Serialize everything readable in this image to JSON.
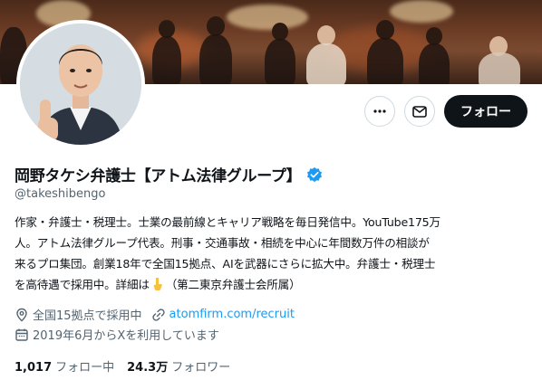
{
  "profile": {
    "display_name": "岡野タケシ弁護士【アトム法律グループ】",
    "handle": "@takeshibengo",
    "bio_line1": "作家・弁護士・税理士。士業の最前線とキャリア戦略を毎日発信中。YouTube175万",
    "bio_line2": "人。アトム法律グループ代表。刑事・交通事故・相続を中心に年間数万件の相談が",
    "bio_line3": "来るプロ集団。創業18年で全国15拠点、AIを武器にさらに拡大中。弁護士・税理士",
    "bio_line4a": "を高待遇で採用中。詳細は",
    "bio_line4b": "（第二東京弁護士会所属）",
    "location": "全国15拠点で採用中",
    "website": "atomfirm.com/recruit",
    "joined": "2019年6月からXを利用しています"
  },
  "stats": {
    "following_count": "1,017",
    "following_label": "フォロー中",
    "followers_count": "24.3万",
    "followers_label": "フォロワー"
  },
  "actions": {
    "follow_label": "フォロー",
    "more_icon": "more-icon",
    "message_icon": "message-icon"
  },
  "icons": {
    "verified": "verified-badge-icon",
    "location": "location-pin-icon",
    "link": "link-icon",
    "calendar": "calendar-icon",
    "pointing": "pointing-down-emoji"
  },
  "colors": {
    "accent": "#1d9bf0",
    "text_primary": "#0f1419",
    "text_secondary": "#536471",
    "follow_button": "#0f1419"
  }
}
